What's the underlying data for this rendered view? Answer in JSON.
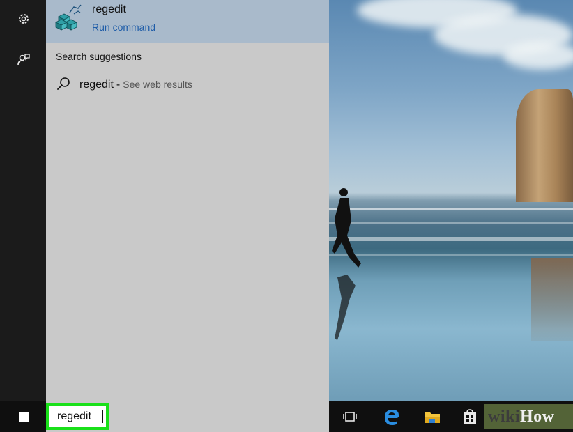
{
  "best_match": {
    "app_name": "regedit",
    "app_type": "Run command",
    "app_icon": "registry-editor-icon"
  },
  "search_suggestions": {
    "heading": "Search suggestions",
    "items": [
      {
        "query": "regedit",
        "separator": "-",
        "action": "See web results",
        "icon": "search-icon"
      }
    ]
  },
  "left_rail": {
    "icons": [
      "settings-icon",
      "feedback-icon"
    ]
  },
  "taskbar": {
    "search_value": "regedit",
    "icons": [
      "windows-logo-icon",
      "task-view-icon",
      "edge-browser-icon",
      "file-explorer-icon",
      "store-icon"
    ],
    "highlight_color": "#19e019"
  },
  "watermark": {
    "wiki": "wiki",
    "how": "How"
  }
}
